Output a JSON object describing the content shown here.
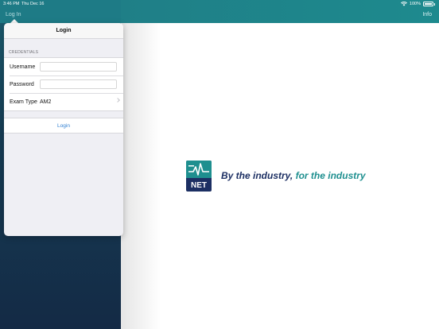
{
  "status_bar": {
    "time": "3:46 PM",
    "date": "Thu Dec 16",
    "battery": "100%"
  },
  "nav": {
    "left_button": "Log In",
    "right_button": "Info"
  },
  "popover": {
    "title": "Login",
    "section_label": "CREDENTIALS",
    "username_label": "Username",
    "username_value": "",
    "password_label": "Password",
    "password_value": "",
    "exam_type_label": "Exam Type",
    "exam_type_value": "AM2",
    "login_button": "Login"
  },
  "logo": {
    "text": "NET",
    "tagline_part1": "By the industry, ",
    "tagline_part2": "for the industry"
  },
  "colors": {
    "teal": "#1e8a8e",
    "navy": "#1c2f63",
    "link": "#2f7fd1"
  }
}
